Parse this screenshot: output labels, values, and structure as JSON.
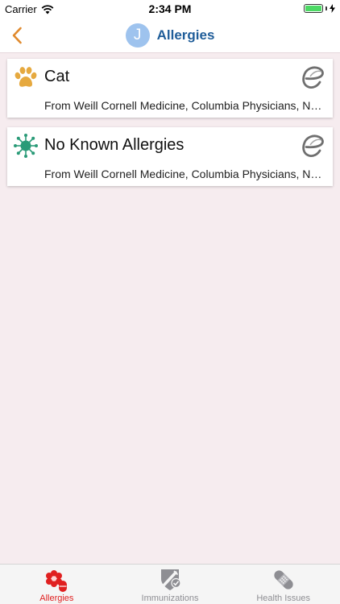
{
  "status_bar": {
    "carrier": "Carrier",
    "time": "2:34 PM"
  },
  "nav": {
    "avatar_initial": "J",
    "title": "Allergies"
  },
  "allergies": [
    {
      "name": "Cat",
      "source": "From Weill Cornell Medicine, Columbia Physicians, NewYork-Presbyterian",
      "icon": "paw-icon"
    },
    {
      "name": "No Known Allergies",
      "source": "From Weill Cornell Medicine, Columbia Physicians, NewYork-Presbyterian",
      "icon": "allergen-icon"
    }
  ],
  "tabs": [
    {
      "label": "Allergies",
      "icon": "allergy-icon",
      "active": true
    },
    {
      "label": "Immunizations",
      "icon": "syringe-shield-icon",
      "active": false
    },
    {
      "label": "Health Issues",
      "icon": "bandage-icon",
      "active": false
    }
  ],
  "colors": {
    "accent_red": "#e02020",
    "title_blue": "#1f5d99",
    "back_orange": "#e08a2e",
    "paw_gold": "#e6a93f",
    "allergen_green": "#2a9b78",
    "background": "#f6ecef"
  }
}
